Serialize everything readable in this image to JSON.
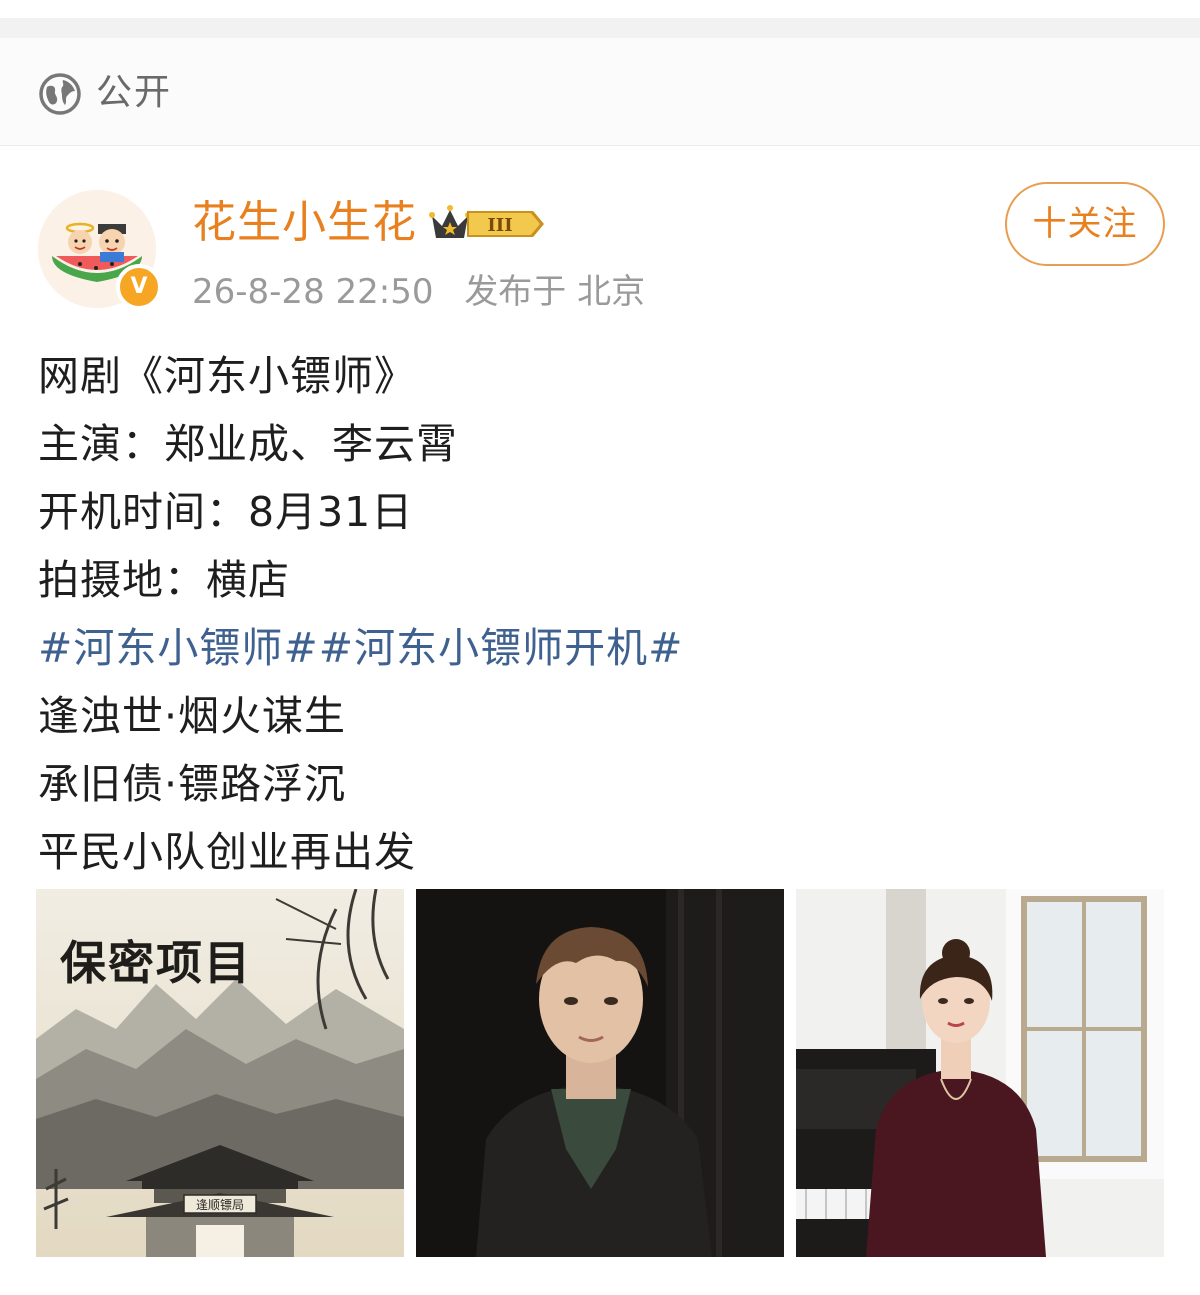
{
  "visibility": {
    "label": "公开",
    "icon": "globe-icon"
  },
  "post": {
    "author": {
      "name": "花生小生花",
      "badge_level": "III",
      "verified_mark": "V",
      "name_color": "#e8801f"
    },
    "timestamp": "26-8-28 22:50",
    "location": "发布于 北京",
    "follow_label": "十关注",
    "lines": {
      "l1": "网剧《河东小镖师》",
      "l2": "主演：郑业成、李云霄",
      "l3": "开机时间：8月31日",
      "l4": "拍摄地：横店",
      "topic1": "#河东小镖师#",
      "topic2": "#河东小镖师开机#",
      "l6": "逢浊世·烟火谋生",
      "l7": "承旧债·镖路浮沉",
      "l8": "平民小队创业再出发"
    },
    "images": {
      "poster_text": "保密项目",
      "gate_sign": "逢顺镖局"
    }
  },
  "colors": {
    "accent": "#e8801f",
    "topic": "#3f6190",
    "meta": "#9a9a9a"
  }
}
